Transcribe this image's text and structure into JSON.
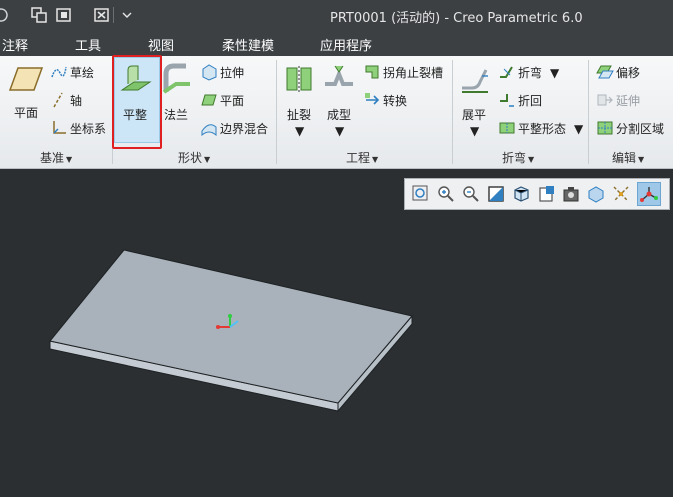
{
  "window": {
    "title": "PRT0001 (活动的) - Creo Parametric 6.0"
  },
  "quick_access": {
    "icons": [
      "regenerate-icon",
      "window-switch-icon",
      "close-window-icon",
      "customize-dropdown-icon"
    ]
  },
  "menu": {
    "items": [
      "注释",
      "工具",
      "视图",
      "柔性建模",
      "应用程序"
    ]
  },
  "ribbon": {
    "groups": {
      "datum": {
        "label": "基准",
        "plane": "平面",
        "sketch": "草绘",
        "axis": "轴",
        "csys": "坐标系"
      },
      "shapes": {
        "label": "形状",
        "planar": "平整",
        "flange": "法兰",
        "extrude": "拉伸",
        "plane": "平面",
        "boundary_blend": "边界混合"
      },
      "engineering": {
        "label": "工程",
        "rip": "扯裂",
        "form": "成型",
        "corner_relief": "拐角止裂槽",
        "convert": "转换"
      },
      "bend": {
        "label": "折弯",
        "unbend": "展平",
        "bend": "折弯",
        "bend_back": "折回",
        "flat_form": "平整形态"
      },
      "editing": {
        "label": "编辑",
        "offset": "偏移",
        "extend": "延伸",
        "split_area": "分割区域"
      }
    },
    "selected_button": "平整"
  },
  "view_toolbar": {
    "icons": [
      "zoom-fit-icon",
      "zoom-in-icon",
      "zoom-out-icon",
      "shading-icon",
      "display-style-icon",
      "view-manager-icon",
      "saved-views-icon",
      "perspective-icon",
      "datum-display-icon",
      "spin-center-icon"
    ],
    "active": "spin-center-icon"
  },
  "colors": {
    "title_bg": "#3c4043",
    "viewport_bg": "#2b2f31",
    "plate_top": "#a9b2bb",
    "plate_side": "#c4cbd2",
    "selection_outline": "#e02020"
  }
}
